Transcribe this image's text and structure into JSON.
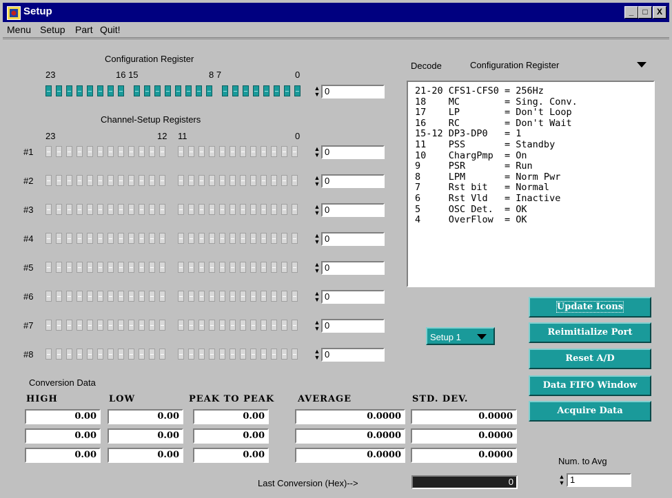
{
  "window": {
    "title": "Setup",
    "btn_min": "_",
    "btn_max": "□",
    "btn_close": "X"
  },
  "menu": [
    "Menu",
    "Setup",
    "Part",
    "Quit!"
  ],
  "config": {
    "title": "Configuration Register",
    "bit_labels": [
      "23",
      "16 15",
      "8 7",
      "0"
    ],
    "value": "0"
  },
  "channel": {
    "title": "Channel-Setup Registers",
    "bit_labels": [
      "23",
      "12",
      "11",
      "0"
    ],
    "rows": [
      {
        "label": "#1",
        "value": "0"
      },
      {
        "label": "#2",
        "value": "0"
      },
      {
        "label": "#3",
        "value": "0"
      },
      {
        "label": "#4",
        "value": "0"
      },
      {
        "label": "#5",
        "value": "0"
      },
      {
        "label": "#6",
        "value": "0"
      },
      {
        "label": "#7",
        "value": "0"
      },
      {
        "label": "#8",
        "value": "0"
      }
    ]
  },
  "decode": {
    "label": "Decode",
    "selected": "Configuration Register",
    "lines": [
      "21-20 CFS1-CFS0 = 256Hz",
      "18    MC        = Sing. Conv.",
      "17    LP        = Don't Loop",
      "16    RC        = Don't Wait",
      "15-12 DP3-DP0   = 1",
      "11    PSS       = Standby",
      "10    ChargPmp  = On",
      "9     PSR       = Run",
      "8     LPM       = Norm Pwr",
      "7     Rst bit   = Normal",
      "6     Rst Vld   = Inactive",
      "5     OSC Det.  = OK",
      "4     OverFlow  = OK"
    ]
  },
  "setup_select": "Setup 1",
  "buttons": {
    "update": "Update Icons",
    "reinit": "Reimitialize Port",
    "reset": "Reset A/D",
    "fifo": "Data FIFO Window",
    "acquire": "Acquire Data"
  },
  "conversion": {
    "title": "Conversion Data",
    "headers": [
      "HIGH",
      "LOW",
      "PEAK TO PEAK",
      "AVERAGE",
      "STD. DEV."
    ],
    "rows": [
      [
        "0.00",
        "0.00",
        "0.00",
        "0.0000",
        "0.0000"
      ],
      [
        "0.00",
        "0.00",
        "0.00",
        "0.0000",
        "0.0000"
      ],
      [
        "0.00",
        "0.00",
        "0.00",
        "0.0000",
        "0.0000"
      ]
    ]
  },
  "last_conversion": {
    "label": "Last Conversion (Hex)-->",
    "value": "0"
  },
  "num_avg": {
    "label": "Num. to Avg",
    "value": "1"
  },
  "colors": {
    "title_bg": "#000080",
    "teal": "#1a9a9a",
    "window_bg": "#c0c0c0"
  }
}
